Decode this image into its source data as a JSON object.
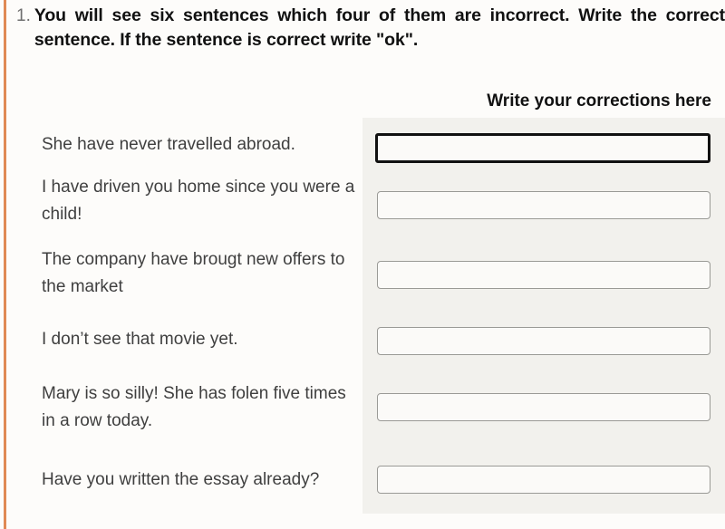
{
  "page": {
    "background_color": "#fdfcfa",
    "accent_color": "#e08a55",
    "panel_color": "#f2f1ed"
  },
  "instruction": {
    "marker": "1.",
    "text": "You will see six sentences which four of them are incorrect. Write the correct sentence. If the sentence is correct write \"ok\"."
  },
  "corrections_heading": "Write your corrections here",
  "sentences": [
    {
      "text": "She have never travelled abroad."
    },
    {
      "text": "I have driven you home since you were a child!"
    },
    {
      "text": "The company have brougt new offers to the market"
    },
    {
      "text": "I don’t see that movie yet."
    },
    {
      "text": "Mary is so silly! She has folen five times in a row today."
    },
    {
      "text": "Have you written the essay already?"
    }
  ],
  "answer_boxes": [
    {
      "value": "",
      "placeholder": "",
      "focused": true
    },
    {
      "value": "",
      "placeholder": "",
      "focused": false
    },
    {
      "value": "",
      "placeholder": "",
      "focused": false
    },
    {
      "value": "",
      "placeholder": "",
      "focused": false
    },
    {
      "value": "",
      "placeholder": "",
      "focused": false
    },
    {
      "value": "",
      "placeholder": "",
      "focused": false
    }
  ]
}
